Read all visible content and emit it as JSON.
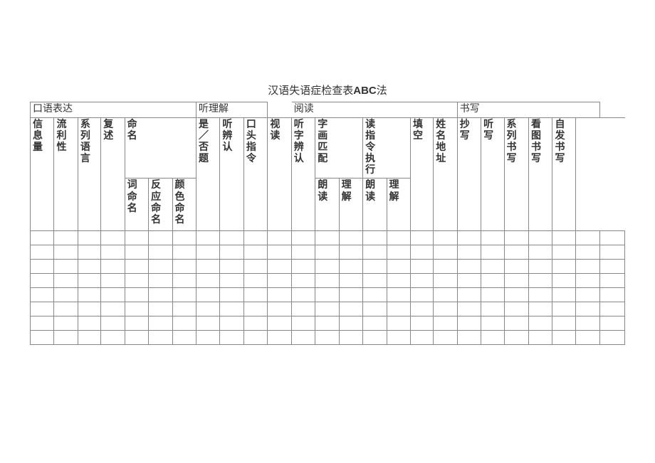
{
  "title_prefix": "汉语失语症检查表",
  "title_method": "ABC",
  "title_suffix": "法",
  "sections": {
    "oral": "口语表达",
    "listen": "听理解",
    "gap1": "",
    "read": "阅读",
    "write": "书写",
    "gap2": ""
  },
  "cols": [
    "信息量",
    "流利性",
    "系列语言",
    "复述",
    "命名",
    "词命名",
    "反应命名",
    "颜色命名",
    "是／否题",
    "听辨认",
    "口头指令",
    "视读",
    "听字辨认",
    "字画匹配",
    "朗读",
    "理解",
    "读指令执行",
    "朗读",
    "理解",
    "填空",
    "姓名地址",
    "抄写",
    "听写",
    "系列书写",
    "看图书写",
    "自发书写"
  ],
  "data_rows": [
    [
      "",
      "",
      "",
      "",
      "",
      "",
      "",
      "",
      "",
      "",
      "",
      "",
      "",
      "",
      "",
      "",
      "",
      "",
      "",
      "",
      "",
      "",
      "",
      "",
      "",
      ""
    ],
    [
      "",
      "",
      "",
      "",
      "",
      "",
      "",
      "",
      "",
      "",
      "",
      "",
      "",
      "",
      "",
      "",
      "",
      "",
      "",
      "",
      "",
      "",
      "",
      "",
      "",
      ""
    ],
    [
      "",
      "",
      "",
      "",
      "",
      "",
      "",
      "",
      "",
      "",
      "",
      "",
      "",
      "",
      "",
      "",
      "",
      "",
      "",
      "",
      "",
      "",
      "",
      "",
      "",
      ""
    ],
    [
      "",
      "",
      "",
      "",
      "",
      "",
      "",
      "",
      "",
      "",
      "",
      "",
      "",
      "",
      "",
      "",
      "",
      "",
      "",
      "",
      "",
      "",
      "",
      "",
      "",
      ""
    ],
    [
      "",
      "",
      "",
      "",
      "",
      "",
      "",
      "",
      "",
      "",
      "",
      "",
      "",
      "",
      "",
      "",
      "",
      "",
      "",
      "",
      "",
      "",
      "",
      "",
      "",
      ""
    ],
    [
      "",
      "",
      "",
      "",
      "",
      "",
      "",
      "",
      "",
      "",
      "",
      "",
      "",
      "",
      "",
      "",
      "",
      "",
      "",
      "",
      "",
      "",
      "",
      "",
      "",
      ""
    ],
    [
      "",
      "",
      "",
      "",
      "",
      "",
      "",
      "",
      "",
      "",
      "",
      "",
      "",
      "",
      "",
      "",
      "",
      "",
      "",
      "",
      "",
      "",
      "",
      "",
      "",
      ""
    ],
    [
      "",
      "",
      "",
      "",
      "",
      "",
      "",
      "",
      "",
      "",
      "",
      "",
      "",
      "",
      "",
      "",
      "",
      "",
      "",
      "",
      "",
      "",
      "",
      "",
      "",
      ""
    ]
  ]
}
